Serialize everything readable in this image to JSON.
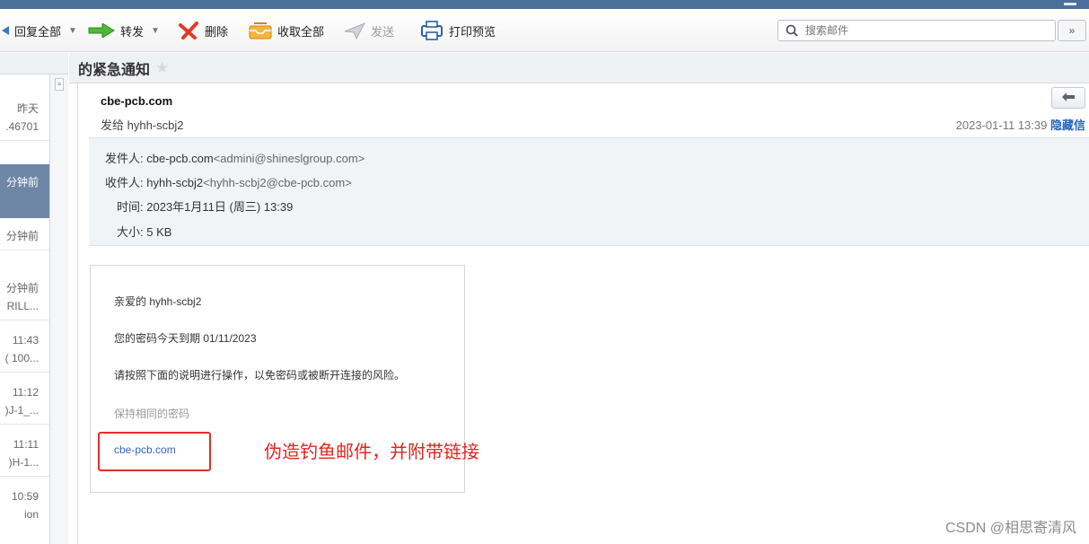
{
  "toolbar": {
    "reply_all": "回复全部",
    "forward": "转发",
    "delete": "删除",
    "receive_all": "收取全部",
    "send": "发送",
    "print_preview": "打印预览"
  },
  "search": {
    "placeholder": "搜索邮件"
  },
  "message_list": {
    "items": [
      {
        "line1": "昨天",
        "line2": ".46701"
      },
      {
        "line1": "分钟前",
        "line2": ""
      },
      {
        "line1": "分钟前",
        "line2": ""
      },
      {
        "line1": "分钟前",
        "line2": "RILL..."
      },
      {
        "line1": "11:43",
        "line2": "( 100..."
      },
      {
        "line1": "11:12",
        "line2": ")J-1_..."
      },
      {
        "line1": "11:11",
        "line2": ")H-1..."
      },
      {
        "line1": "10:59",
        "line2": "ion"
      }
    ]
  },
  "message": {
    "subject": "的紧急通知",
    "sender_name": "cbe-pcb.com",
    "to_prefix": "发给",
    "to_name": "hyhh-scbj2",
    "date": "2023-01-11 13:39",
    "hide_link": "隐藏信",
    "details": {
      "from_label": "发件人:",
      "from_name": "cbe-pcb.com",
      "from_addr": "<admini@shineslgroup.com>",
      "to_label": "收件人:",
      "to_name": "hyhh-scbj2",
      "to_addr": "<hyhh-scbj2@cbe-pcb.com>",
      "time_label": "时间:",
      "time_value": "2023年1月11日 (周三) 13:39",
      "size_label": "大小:",
      "size_value": "5 KB"
    },
    "body": {
      "greeting": "亲爱的 hyhh-scbj2",
      "expire": "您的密码今天到期 01/11/2023",
      "instruction": "请按照下面的说明进行操作，以免密码或被断开连接的风险。",
      "keep_password": "保持相同的密码",
      "link": "cbe-pcb.com"
    }
  },
  "annotation": "伪造钓鱼邮件，并附带链接",
  "watermark": "CSDN @相思寄清风",
  "colors": {
    "annotation": "#e3241e",
    "highlight_box": "#e52d2d",
    "link": "#3466b8",
    "selected_row": "#6f87a6"
  }
}
